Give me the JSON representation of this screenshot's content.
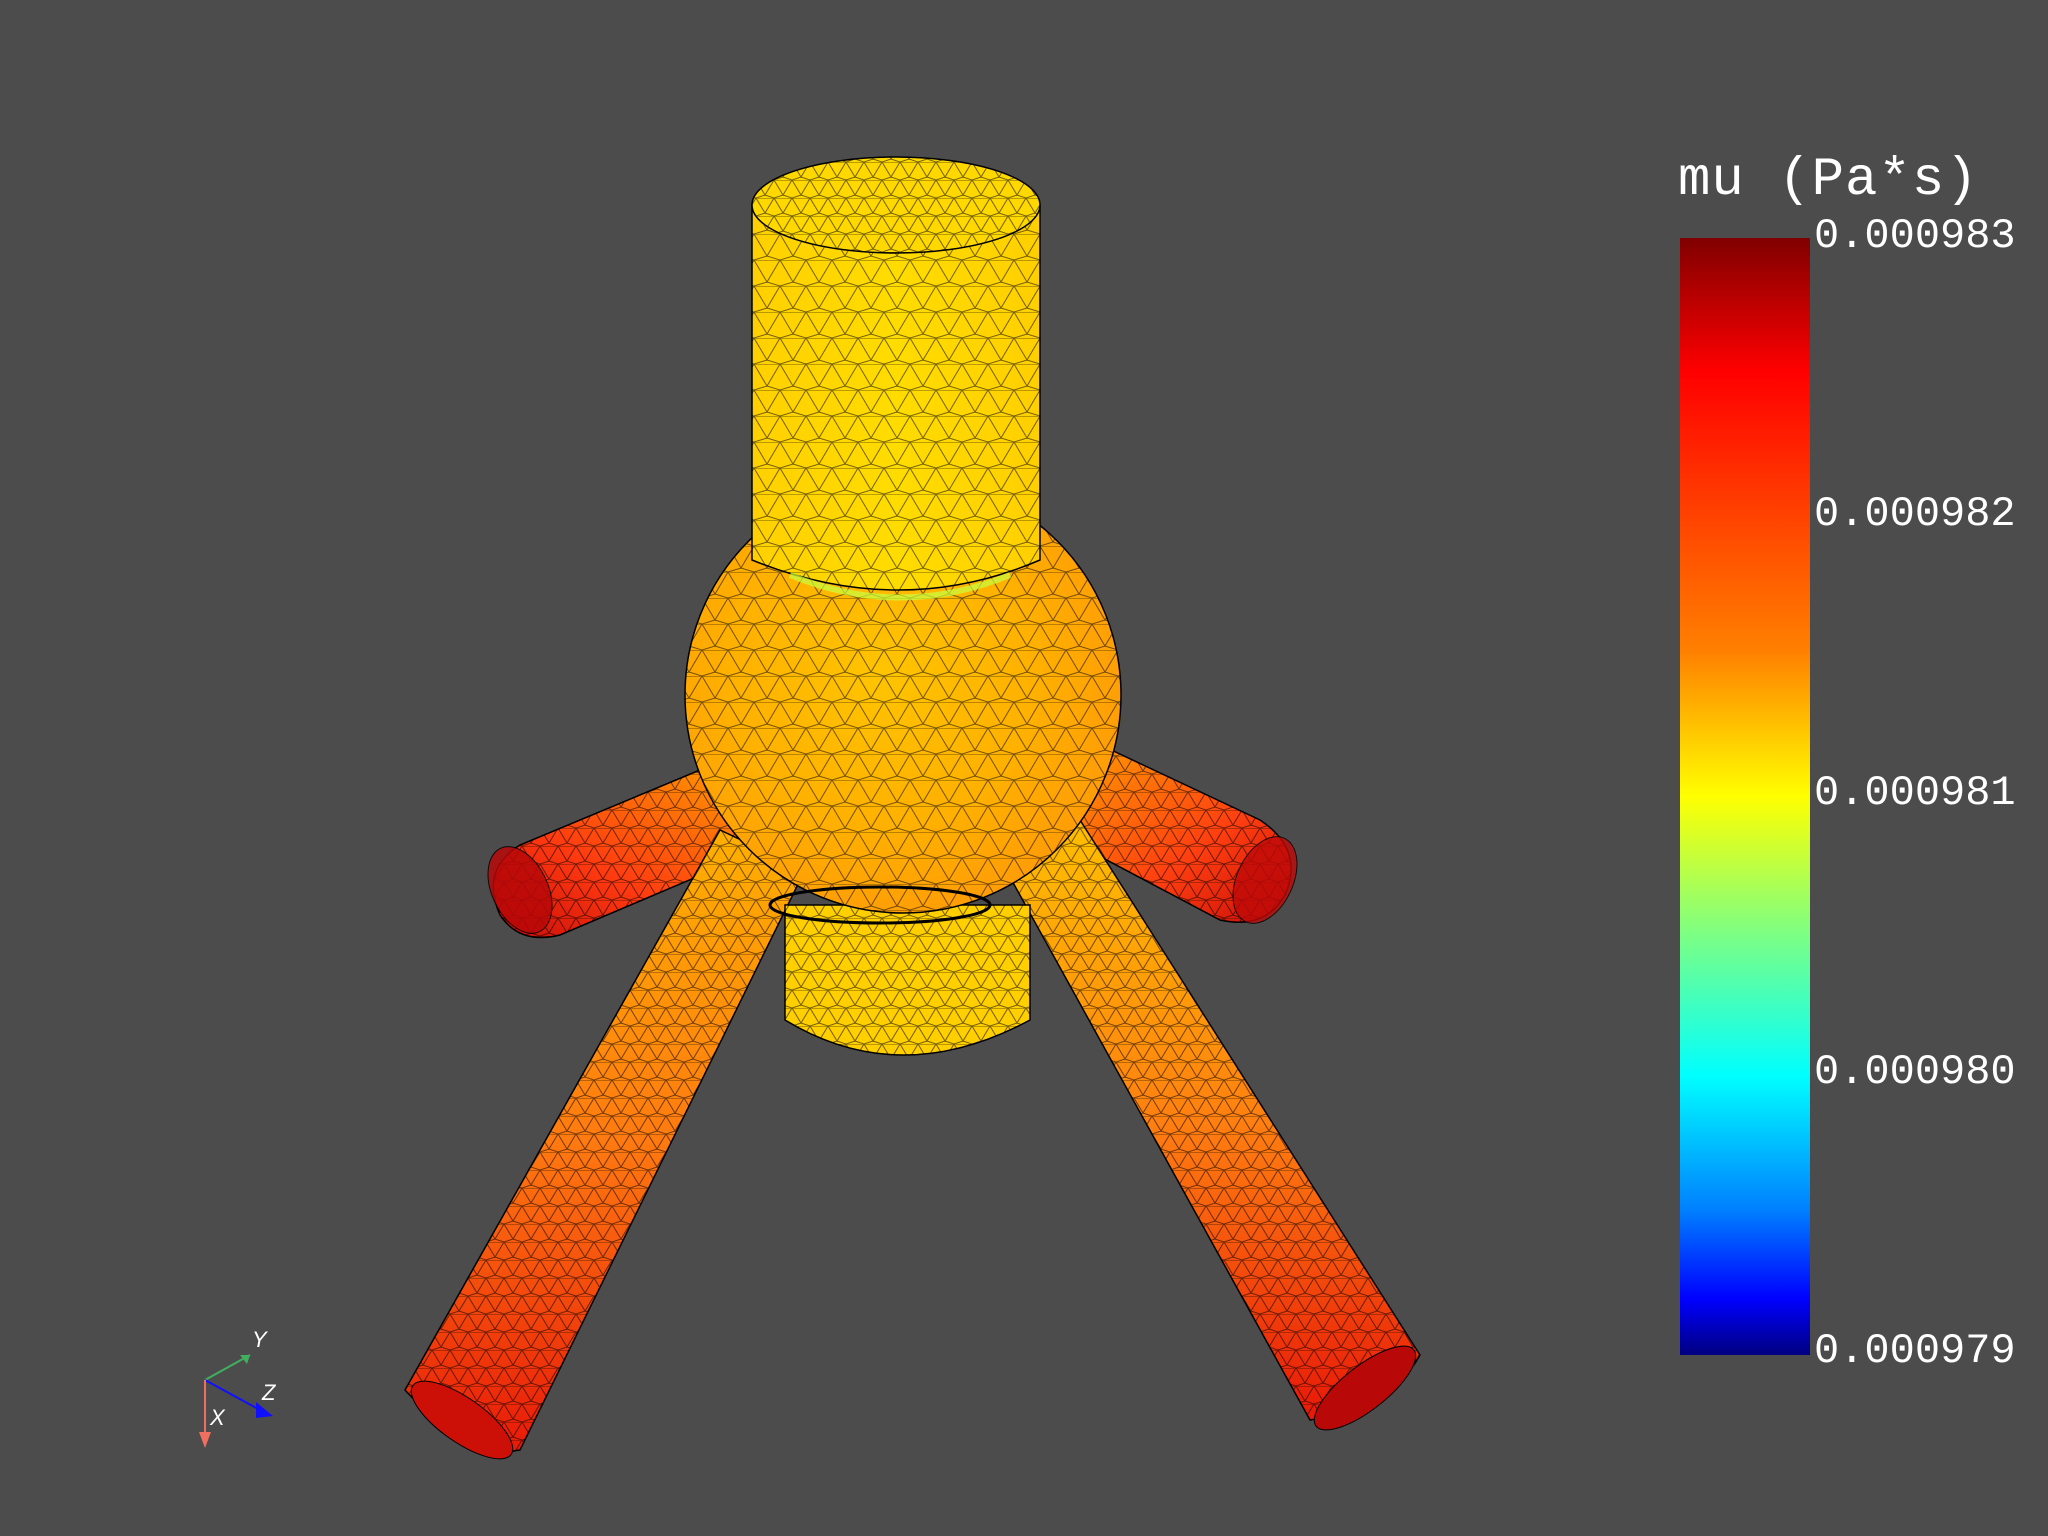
{
  "window": {
    "background_color": "#4c4c4c"
  },
  "colorbar": {
    "title": "mu (Pa*s)",
    "colormap": "jet",
    "ticks": [
      "0.000983",
      "0.000982",
      "0.000981",
      "0.000980",
      "0.000979"
    ],
    "max": 0.000983,
    "min": 0.000979
  },
  "axes_widget": {
    "x_label": "X",
    "y_label": "Y",
    "z_label": "Z",
    "x_color": "#f07060",
    "y_color": "#40b060",
    "z_color": "#1010ff"
  },
  "mesh": {
    "edge_color": "#000000",
    "body_color": "#ffd400",
    "outlet_color": "#ff2a10"
  }
}
